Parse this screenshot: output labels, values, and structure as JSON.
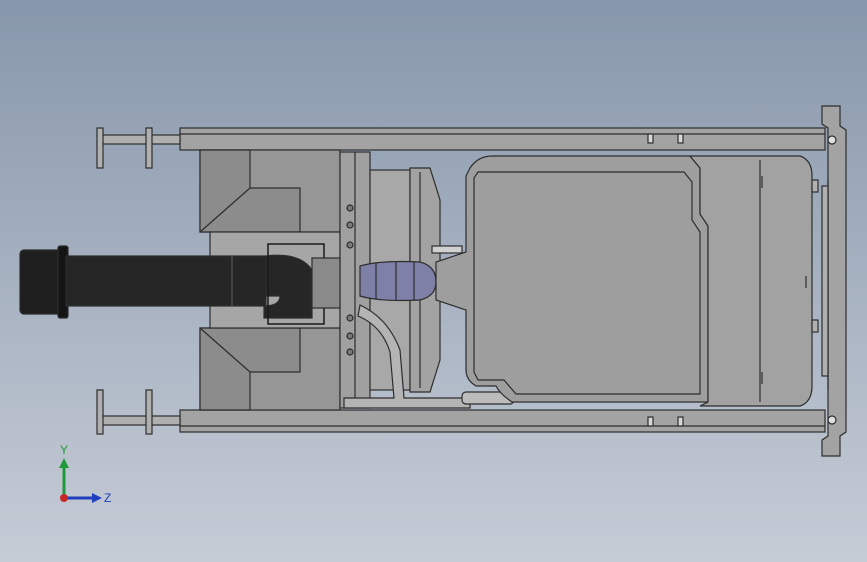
{
  "viewport": {
    "background_top": "#8797ab",
    "background_bottom": "#c6ccd6",
    "model_stroke": "#2d2d2d",
    "frame_fill": "#9a9a9a",
    "tank_fill": "#9e9e9e",
    "pipe_fill": "#1e1e1e",
    "filter_fill": "#7e80a8"
  },
  "triad": {
    "y_label": "Y",
    "z_label": "Z",
    "y_color": "#1f9a3a",
    "z_color": "#1f3fbf",
    "origin_color": "#c62828"
  }
}
